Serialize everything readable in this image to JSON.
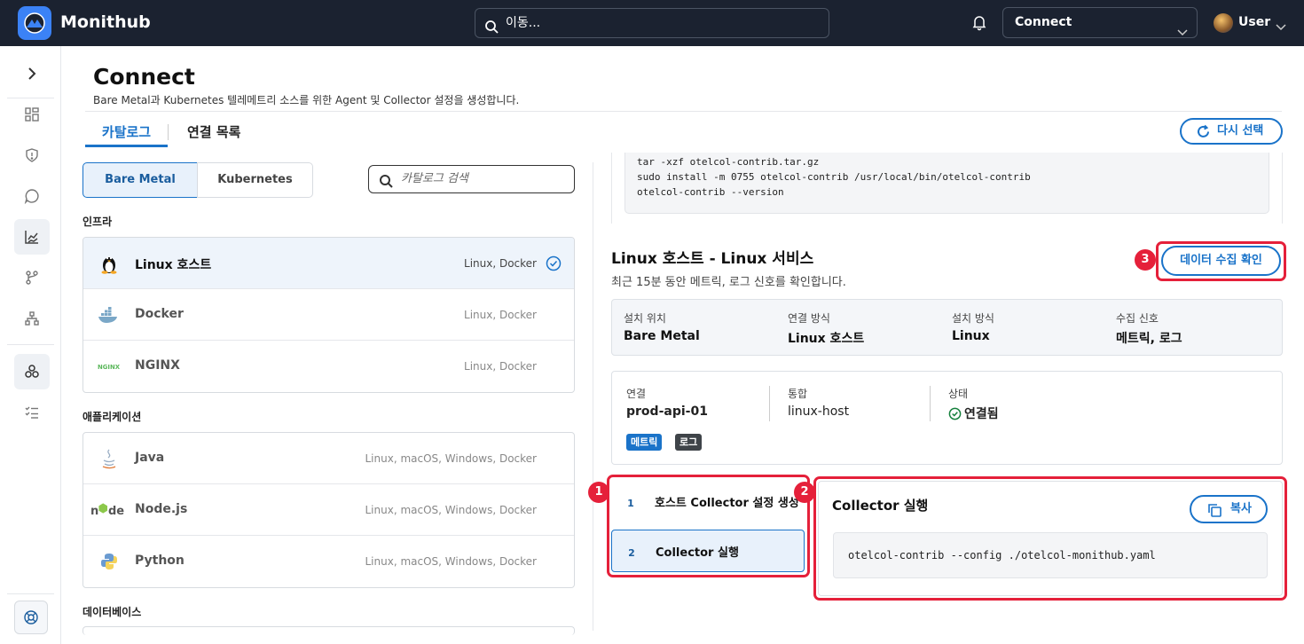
{
  "topbar": {
    "brand": "Monithub",
    "search_placeholder": "이동...",
    "workspace": "Connect",
    "user": "User"
  },
  "page": {
    "title": "Connect",
    "subtitle": "Bare Metal과 Kubernetes 텔레메트리 소스를 위한 Agent 및 Collector 설정을 생성합니다."
  },
  "tabs": {
    "catalog": "카탈로그",
    "connections": "연결 목록"
  },
  "reset_label": "다시 선택",
  "segment": {
    "bare_metal": "Bare Metal",
    "kubernetes": "Kubernetes"
  },
  "catalog_search_placeholder": "카탈로그 검색",
  "sections": {
    "infra": "인프라",
    "apps": "애플리케이션",
    "db": "데이터베이스"
  },
  "infra_items": [
    {
      "name": "Linux 호스트",
      "platforms": "Linux, Docker"
    },
    {
      "name": "Docker",
      "platforms": "Linux, Docker"
    },
    {
      "name": "NGINX",
      "platforms": "Linux, Docker"
    }
  ],
  "app_items": [
    {
      "name": "Java",
      "platforms": "Linux, macOS, Windows, Docker"
    },
    {
      "name": "Node.js",
      "platforms": "Linux, macOS, Windows, Docker"
    },
    {
      "name": "Python",
      "platforms": "Linux, macOS, Windows, Docker"
    }
  ],
  "install_code": [
    "tar -xzf otelcol-contrib.tar.gz",
    "sudo install -m 0755 otelcol-contrib /usr/local/bin/otelcol-contrib",
    "otelcol-contrib --version"
  ],
  "verify": {
    "title": "Linux 호스트 - Linux 서비스",
    "desc": "최근 15분 동안 메트릭, 로그 신호를 확인합니다.",
    "button": "데이터 수집 확인"
  },
  "summary": [
    {
      "k": "설치 위치",
      "v": "Bare Metal"
    },
    {
      "k": "연결 방식",
      "v": "Linux 호스트"
    },
    {
      "k": "설치 방식",
      "v": "Linux"
    },
    {
      "k": "수집 신호",
      "v": "메트릭, 로그"
    }
  ],
  "connection": {
    "conn_label": "연결",
    "conn_value": "prod-api-01",
    "integ_label": "통합",
    "integ_value": "linux-host",
    "status_label": "상태",
    "status_value": "연결됨",
    "tags": [
      "메트릭",
      "로그"
    ]
  },
  "steps": [
    {
      "num": "1",
      "label": "호스트 Collector 설정 생성"
    },
    {
      "num": "2",
      "label": "Collector 실행"
    }
  ],
  "run": {
    "title": "Collector 실행",
    "copy": "복사",
    "command": "otelcol-contrib --config ./otelcol-monithub.yaml"
  },
  "annotations": [
    "1",
    "2",
    "3"
  ],
  "colors": {
    "accent": "#1a73c9",
    "highlight": "#e5203a",
    "topbar": "#1b2230",
    "success": "#15803d"
  }
}
